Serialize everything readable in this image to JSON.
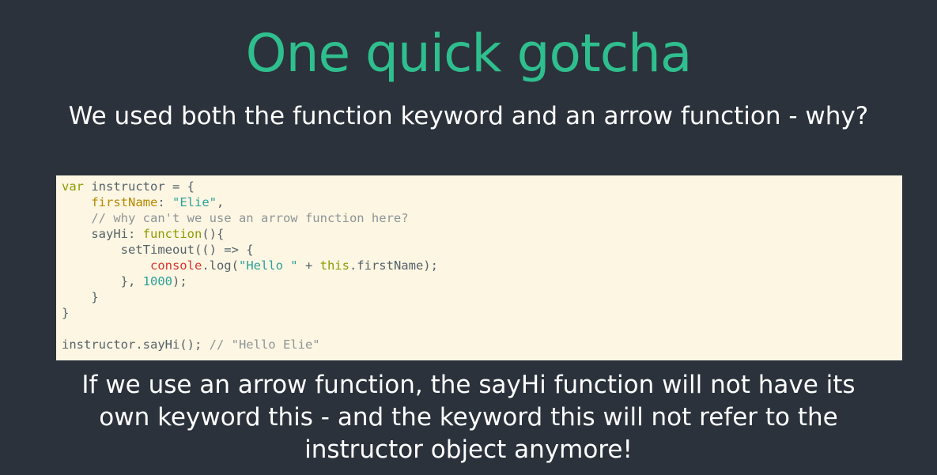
{
  "slide": {
    "title": "One quick gotcha",
    "subtitle": "We used both the function keyword and an arrow function - why?",
    "explanation": "If we use an arrow function, the sayHi function will not have its own keyword this - and the keyword this will not refer to the instructor object anymore!"
  },
  "code": {
    "lines": [
      [
        {
          "t": "var",
          "c": "kw"
        },
        {
          "t": " instructor = {",
          "c": ""
        }
      ],
      [
        {
          "t": "    ",
          "c": ""
        },
        {
          "t": "firstName",
          "c": "prop"
        },
        {
          "t": ": ",
          "c": ""
        },
        {
          "t": "\"Elie\"",
          "c": "str"
        },
        {
          "t": ",",
          "c": ""
        }
      ],
      [
        {
          "t": "    // why can't we use an arrow function here?",
          "c": "cmt"
        }
      ],
      [
        {
          "t": "    sayHi: ",
          "c": ""
        },
        {
          "t": "function",
          "c": "fn"
        },
        {
          "t": "(){",
          "c": ""
        }
      ],
      [
        {
          "t": "        setTimeout(() => {",
          "c": ""
        }
      ],
      [
        {
          "t": "            ",
          "c": ""
        },
        {
          "t": "console",
          "c": "err"
        },
        {
          "t": ".log(",
          "c": ""
        },
        {
          "t": "\"Hello \"",
          "c": "str"
        },
        {
          "t": " + ",
          "c": ""
        },
        {
          "t": "this",
          "c": "kw"
        },
        {
          "t": ".firstName);",
          "c": ""
        }
      ],
      [
        {
          "t": "        }, ",
          "c": ""
        },
        {
          "t": "1000",
          "c": "num"
        },
        {
          "t": ");",
          "c": ""
        }
      ],
      [
        {
          "t": "    }",
          "c": ""
        }
      ],
      [
        {
          "t": "}",
          "c": ""
        }
      ],
      [
        {
          "t": "",
          "c": ""
        }
      ],
      [
        {
          "t": "instructor.sayHi(); ",
          "c": ""
        },
        {
          "t": "// \"Hello Elie\"",
          "c": "cmt"
        }
      ]
    ]
  }
}
